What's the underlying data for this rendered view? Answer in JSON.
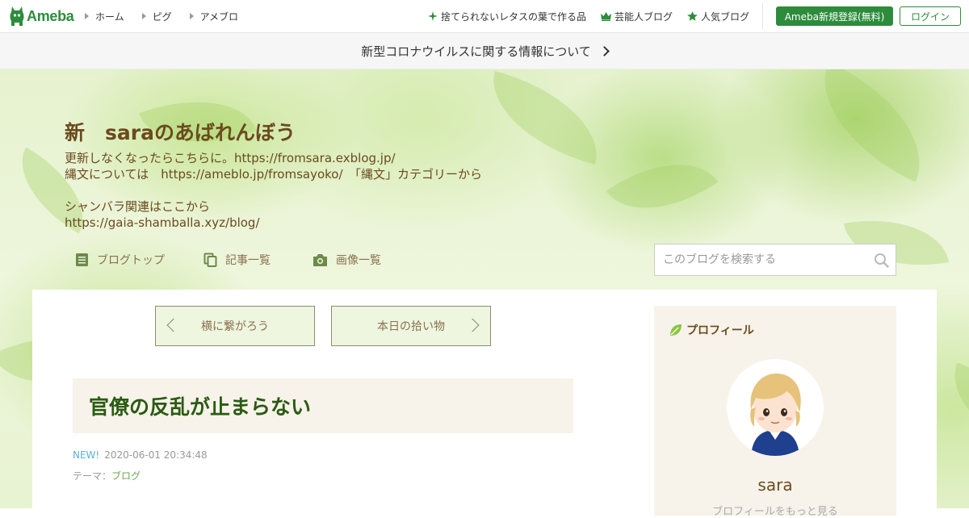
{
  "topbar": {
    "logo_text": "Ameba",
    "nav": [
      {
        "label": "ホーム"
      },
      {
        "label": "ピグ"
      },
      {
        "label": "アメブロ"
      }
    ],
    "right_links": [
      {
        "label": "捨てられないレタスの葉で作る品",
        "icon": "sparkle-icon"
      },
      {
        "label": "芸能人ブログ",
        "icon": "crown-icon"
      },
      {
        "label": "人気ブログ",
        "icon": "star-icon"
      }
    ],
    "register_label": "Ameba新規登録(無料)",
    "login_label": "ログイン",
    "accent": "#2d8c3c"
  },
  "notice": {
    "text": "新型コロナウイルスに関する情報について"
  },
  "blog": {
    "title": "新　saraのあばれんぼう",
    "description_lines": [
      "更新しなくなったらこちらに。https://fromsara.exblog.jp/",
      "縄文については　https://ameblo.jp/fromsayoko/　「縄文」カテゴリーから",
      "",
      "シャンバラ関連はここから",
      "https://gaia-shamballa.xyz/blog/"
    ],
    "nav": [
      {
        "label": "ブログトップ",
        "icon": "document-icon"
      },
      {
        "label": "記事一覧",
        "icon": "copy-icon"
      },
      {
        "label": "画像一覧",
        "icon": "camera-icon"
      }
    ],
    "search_placeholder": "このブログを検索する"
  },
  "pager": {
    "prev_label": "横に繋がろう",
    "next_label": "本日の拾い物"
  },
  "article": {
    "title": "官僚の反乱が止まらない",
    "new_badge": "NEW!",
    "datetime": "2020-06-01 20:34:48",
    "theme_label": "テーマ：",
    "theme_value": "ブログ"
  },
  "profile": {
    "heading": "プロフィール",
    "name": "sara",
    "subtitle": "ブロフィールをもっと見る"
  }
}
